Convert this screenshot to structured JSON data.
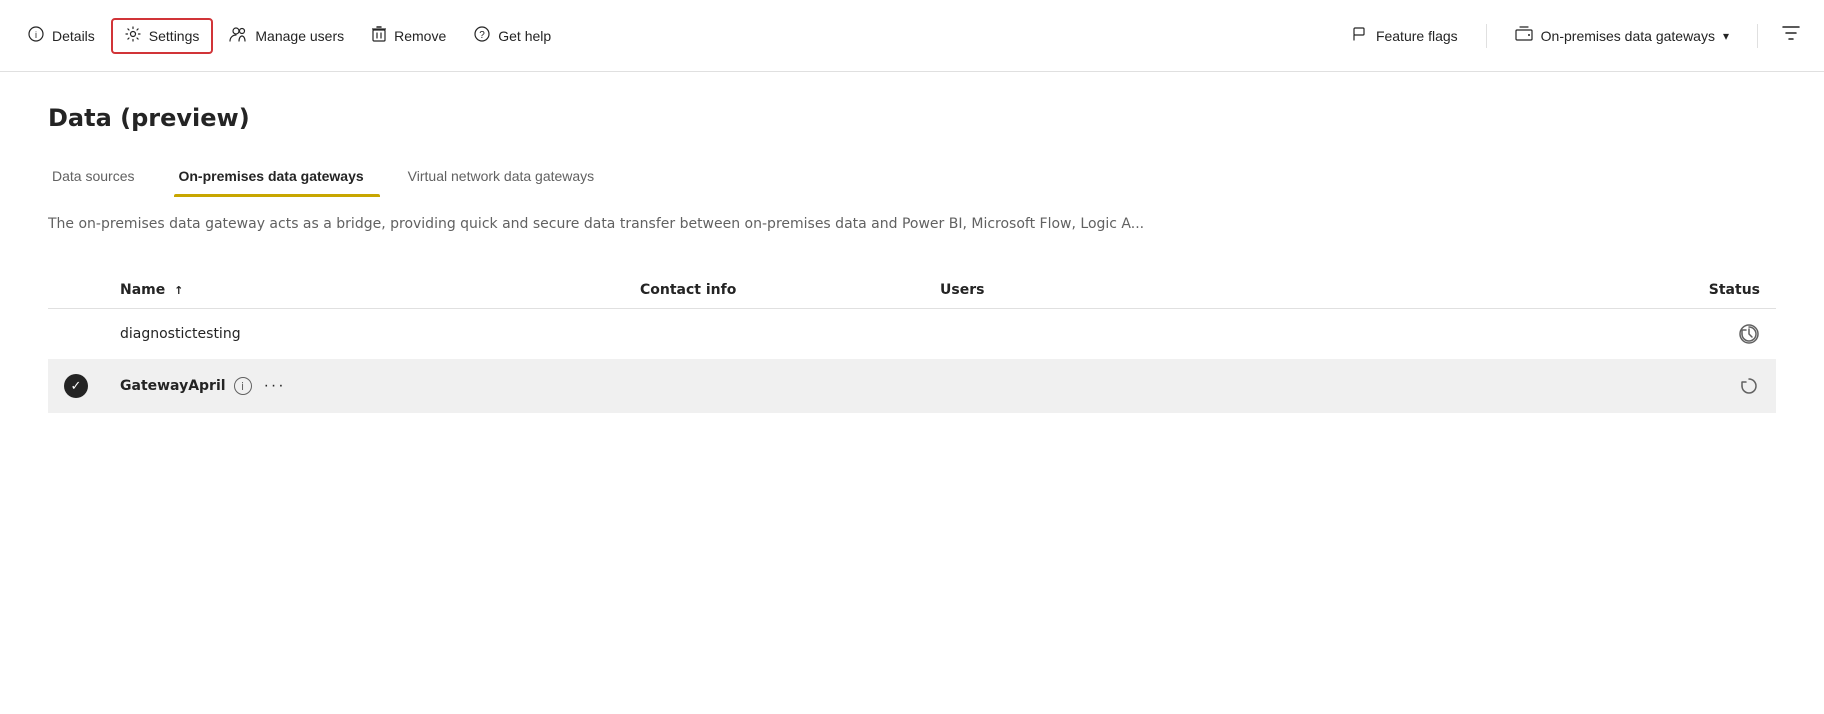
{
  "toolbar": {
    "left_buttons": [
      {
        "id": "details",
        "label": "Details",
        "icon": "ℹ",
        "highlighted": false
      },
      {
        "id": "settings",
        "label": "Settings",
        "icon": "⚙",
        "highlighted": true
      },
      {
        "id": "manage-users",
        "label": "Manage users",
        "icon": "👥",
        "highlighted": false
      },
      {
        "id": "remove",
        "label": "Remove",
        "icon": "🗑",
        "highlighted": false
      },
      {
        "id": "get-help",
        "label": "Get help",
        "icon": "?",
        "highlighted": false
      }
    ],
    "right_buttons": [
      {
        "id": "feature-flags",
        "label": "Feature flags",
        "icon": "🚩"
      },
      {
        "id": "on-premises-gateways",
        "label": "On-premises data gateways"
      }
    ],
    "filter_icon": "≡"
  },
  "page": {
    "title": "Data (preview)",
    "description": "The on-premises data gateway acts as a bridge, providing quick and secure data transfer between on-premises data and Power BI, Microsoft Flow, Logic A..."
  },
  "tabs": [
    {
      "id": "data-sources",
      "label": "Data sources",
      "active": false
    },
    {
      "id": "on-premises",
      "label": "On-premises data gateways",
      "active": true
    },
    {
      "id": "virtual-network",
      "label": "Virtual network data gateways",
      "active": false
    }
  ],
  "table": {
    "columns": [
      {
        "id": "name",
        "label": "Name",
        "sort": "↑"
      },
      {
        "id": "contact",
        "label": "Contact info"
      },
      {
        "id": "users",
        "label": "Users"
      },
      {
        "id": "status",
        "label": "Status"
      }
    ],
    "rows": [
      {
        "id": "row1",
        "selected": false,
        "checkbox": false,
        "name": "diagnostictesting",
        "contact": "",
        "users": "",
        "status": "↻"
      },
      {
        "id": "row2",
        "selected": true,
        "checkbox": true,
        "name": "GatewayApril",
        "contact": "",
        "users": "",
        "status": "↻",
        "has_info": true,
        "has_more": true
      }
    ]
  }
}
